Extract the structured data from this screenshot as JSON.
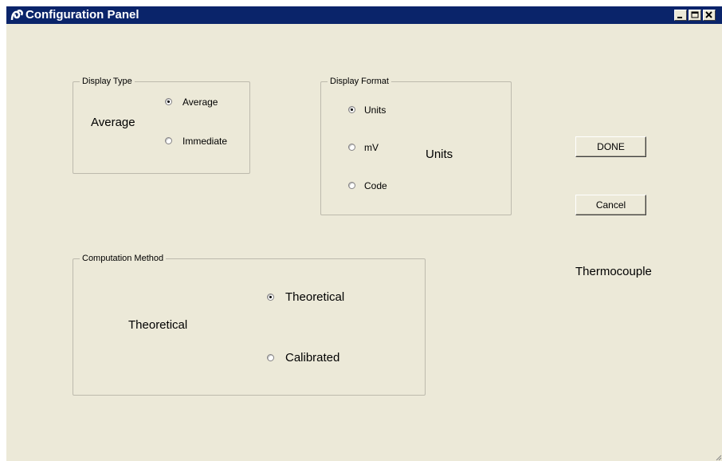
{
  "window": {
    "title": "Configuration Panel",
    "controls": {
      "minimize": "minimize",
      "maximize": "maximize",
      "close": "close"
    }
  },
  "display_type": {
    "legend": "Display Type",
    "current_value": "Average",
    "options": [
      {
        "label": "Average",
        "checked": true
      },
      {
        "label": "Immediate",
        "checked": false
      }
    ]
  },
  "display_format": {
    "legend": "Display Format",
    "current_value": "Units",
    "options": [
      {
        "label": "Units",
        "checked": true
      },
      {
        "label": "mV",
        "checked": false
      },
      {
        "label": "Code",
        "checked": false
      }
    ]
  },
  "computation_method": {
    "legend": "Computation Method",
    "current_value": "Theoretical",
    "options": [
      {
        "label": "Theoretical",
        "checked": true
      },
      {
        "label": "Calibrated",
        "checked": false
      }
    ]
  },
  "buttons": {
    "done": "DONE",
    "cancel": "Cancel"
  },
  "sensor_type": "Thermocouple",
  "colors": {
    "titlebar": "#0a246a",
    "window_bg": "#ece9d8"
  }
}
